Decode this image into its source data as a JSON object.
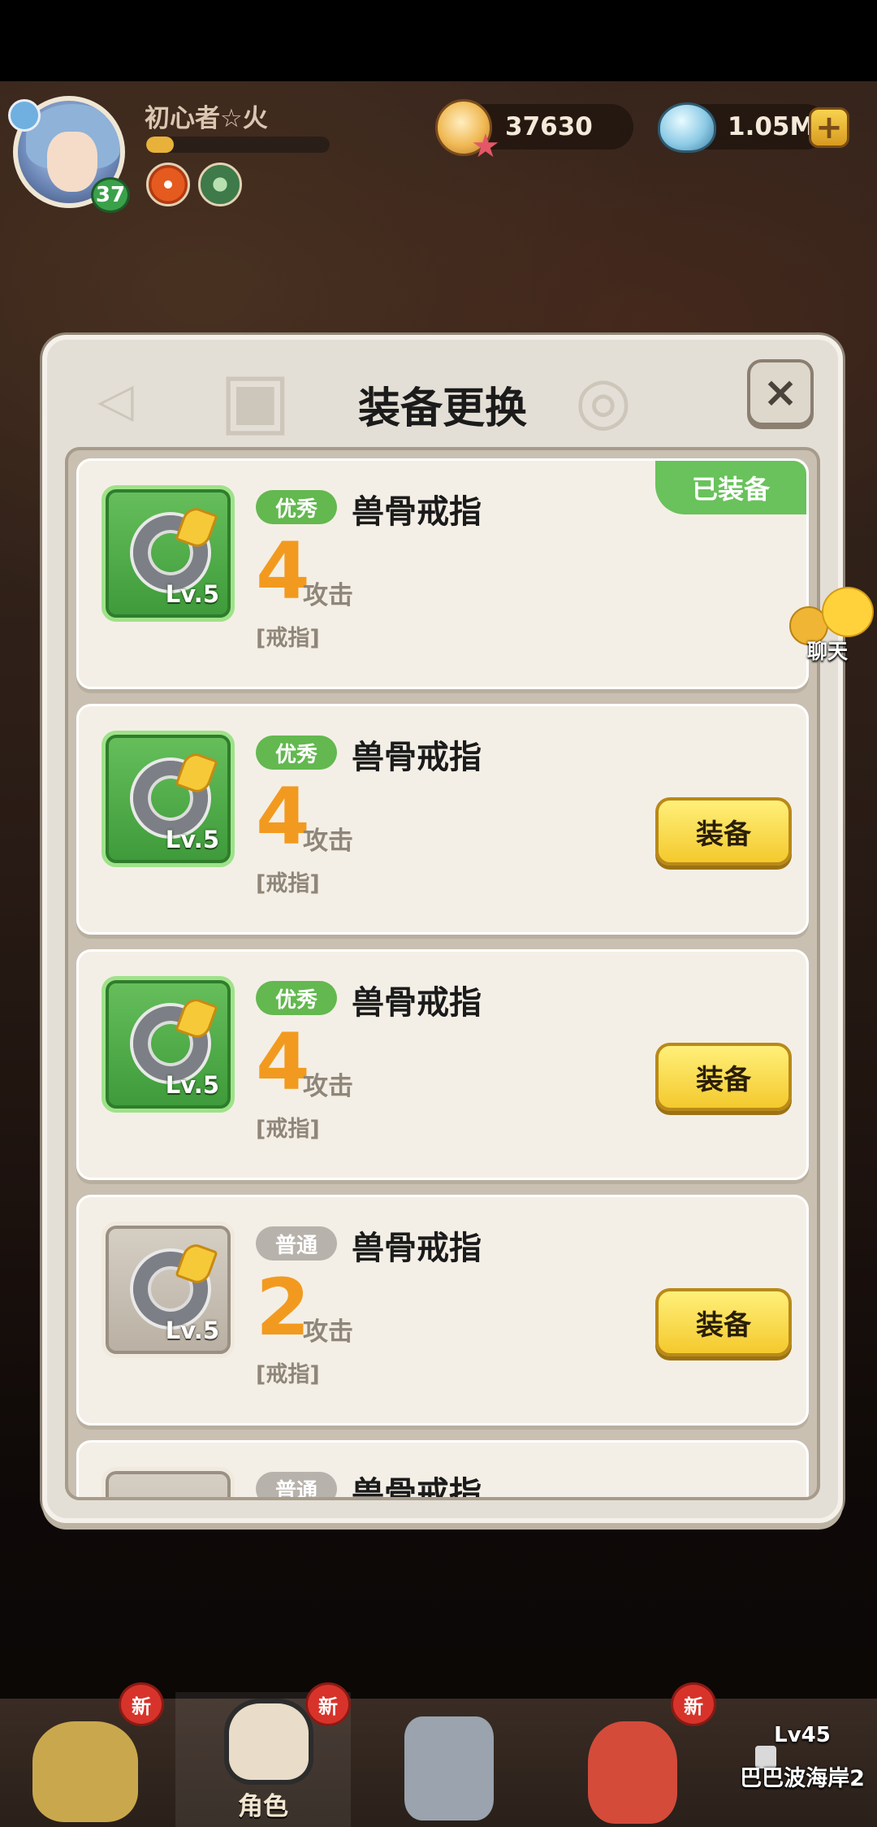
{
  "player": {
    "name": "初心者☆火",
    "level": "37",
    "xp_fraction": 0.15
  },
  "currency": {
    "gold": "37630",
    "gems": "1.05M",
    "plus_label": "+"
  },
  "modal": {
    "title": "装备更换",
    "close_label": "×",
    "items": [
      {
        "quality": "优秀",
        "name": "兽骨戒指",
        "value": "4",
        "stat": "攻击",
        "type": "[戒指]",
        "level": "Lv.5",
        "equipped_label": "已装备"
      },
      {
        "quality": "优秀",
        "name": "兽骨戒指",
        "value": "4",
        "stat": "攻击",
        "type": "[戒指]",
        "level": "Lv.5",
        "button": "装备"
      },
      {
        "quality": "优秀",
        "name": "兽骨戒指",
        "value": "4",
        "stat": "攻击",
        "type": "[戒指]",
        "level": "Lv.5",
        "button": "装备"
      },
      {
        "quality": "普通",
        "name": "兽骨戒指",
        "value": "2",
        "stat": "攻击",
        "type": "[戒指]",
        "level": "Lv.5",
        "button": "装备"
      },
      {
        "quality": "普通",
        "name": "兽骨戒指"
      }
    ]
  },
  "chat": {
    "label": "聊天"
  },
  "bottom_nav": {
    "new_badge": "新",
    "active_label": "角色",
    "locked_level": "Lv45",
    "locked_stage": "巴巴波海岸2"
  },
  "colors": {
    "accent_orange": "#f29a1f",
    "quality_good": "#63b84f",
    "quality_normal": "#b7b2ab",
    "button_yellow": "#f4c92d"
  },
  "icons": [
    "coin-icon",
    "gem-icon",
    "plus-icon",
    "close-icon",
    "ring-icon",
    "chat-icon",
    "lock-icon"
  ]
}
